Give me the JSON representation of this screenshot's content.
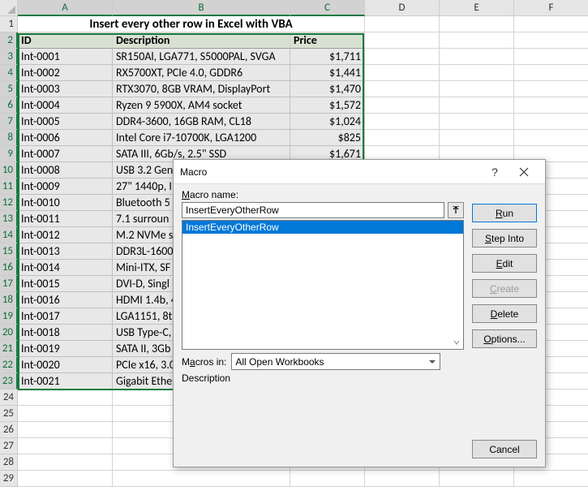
{
  "columns": [
    "A",
    "B",
    "C",
    "D",
    "E",
    "F"
  ],
  "row_numbers": [
    1,
    2,
    3,
    4,
    5,
    6,
    7,
    8,
    9,
    10,
    11,
    12,
    13,
    14,
    15,
    16,
    17,
    18,
    19,
    20,
    21,
    22,
    23,
    24,
    25,
    26,
    27,
    28,
    29
  ],
  "title": "Insert every other row in Excel with VBA",
  "headers": {
    "id": "ID",
    "desc": "Description",
    "price": "Price"
  },
  "rows": [
    {
      "id": "Int-0001",
      "desc": "SR150Al, LGA771, S5000PAL, SVGA",
      "price": "$1,711"
    },
    {
      "id": "Int-0002",
      "desc": "RX5700XT, PCIe 4.0, GDDR6",
      "price": "$1,441"
    },
    {
      "id": "Int-0003",
      "desc": "RTX3070, 8GB VRAM, DisplayPort",
      "price": "$1,470"
    },
    {
      "id": "Int-0004",
      "desc": "Ryzen 9 5900X, AM4 socket",
      "price": "$1,572"
    },
    {
      "id": "Int-0005",
      "desc": "DDR4-3600, 16GB RAM, CL18",
      "price": "$1,024"
    },
    {
      "id": "Int-0006",
      "desc": "Intel Core i7-10700K, LGA1200",
      "price": "$825"
    },
    {
      "id": "Int-0007",
      "desc": "SATA III, 6Gb/s, 2.5\" SSD",
      "price": "$1,671"
    },
    {
      "id": "Int-0008",
      "desc": "USB 3.2 Gen",
      "price": ""
    },
    {
      "id": "Int-0009",
      "desc": "27\" 1440p, I",
      "price": ""
    },
    {
      "id": "Int-0010",
      "desc": "Bluetooth 5",
      "price": ""
    },
    {
      "id": "Int-0011",
      "desc": "7.1 surroun",
      "price": ""
    },
    {
      "id": "Int-0012",
      "desc": "M.2 NVMe s",
      "price": ""
    },
    {
      "id": "Int-0013",
      "desc": "DDR3L-1600",
      "price": ""
    },
    {
      "id": "Int-0014",
      "desc": "Mini-ITX, SF",
      "price": ""
    },
    {
      "id": "Int-0015",
      "desc": "DVI-D, Singl",
      "price": ""
    },
    {
      "id": "Int-0016",
      "desc": "HDMI 1.4b, 4",
      "price": ""
    },
    {
      "id": "Int-0017",
      "desc": "LGA1151, 8t",
      "price": ""
    },
    {
      "id": "Int-0018",
      "desc": "USB Type-C,",
      "price": ""
    },
    {
      "id": "Int-0019",
      "desc": "SATA II, 3Gb",
      "price": ""
    },
    {
      "id": "Int-0020",
      "desc": "PCIe x16, 3.0",
      "price": ""
    },
    {
      "id": "Int-0021",
      "desc": "Gigabit Ethe",
      "price": ""
    }
  ],
  "dialog": {
    "title": "Macro",
    "macro_name_label": "Macro name:",
    "macro_name_value": "InsertEveryOtherRow",
    "macro_list_item": "InsertEveryOtherRow",
    "macros_in_label": "Macros in:",
    "macros_in_value": "All Open Workbooks",
    "description_label": "Description",
    "buttons": {
      "run": "Run",
      "step_into": "Step Into",
      "edit": "Edit",
      "create": "Create",
      "delete": "Delete",
      "options": "Options...",
      "cancel": "Cancel"
    }
  }
}
